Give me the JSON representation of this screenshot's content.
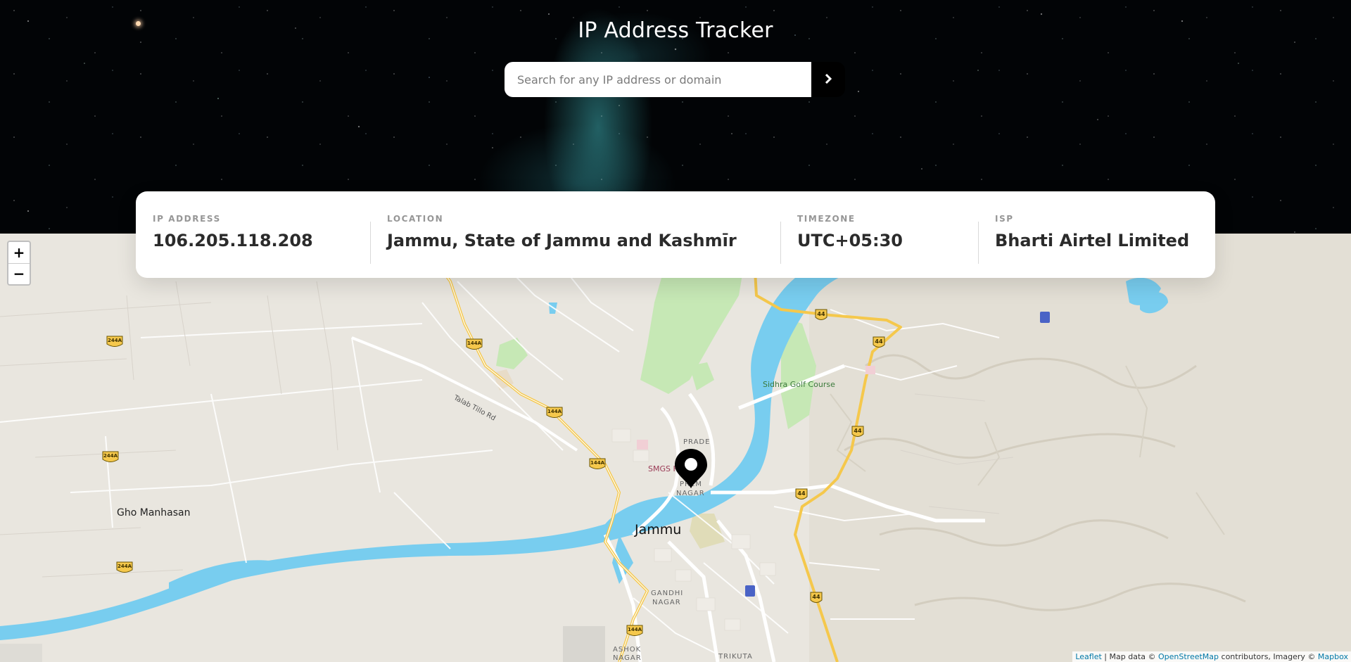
{
  "header": {
    "title": "IP Address Tracker",
    "search_placeholder": "Search for any IP address or domain",
    "search_value": ""
  },
  "info": {
    "ip_label": "IP Address",
    "ip_value": "106.205.118.208",
    "location_label": "Location",
    "location_value": "Jammu, State of Jammu and Kashmīr",
    "timezone_label": "Timezone",
    "timezone_value": "UTC+05:30",
    "isp_label": "ISP",
    "isp_value": "Bharti Airtel Limited"
  },
  "map": {
    "zoom_in": "+",
    "zoom_out": "−",
    "labels": {
      "city": "Jammu",
      "gho": "Gho Manhasan",
      "golf": "Sidhra Golf Course",
      "talab": "Talab Tillo Rd",
      "prade": "PRADE",
      "smgs": "SMGS H",
      "prem": "PREM",
      "nagar1": "NAGAR",
      "gandhi": "GANDHI",
      "nagar2": "NAGAR",
      "ashok": "ASHOK",
      "nagar3": "NAGAR",
      "trikuta": "TRIKUTA"
    },
    "shields": {
      "r244a": "244A",
      "r144a": "144A",
      "r44": "44"
    },
    "attribution": {
      "leaflet": "Leaflet",
      "sep": " | Map data © ",
      "osm": "OpenStreetMap",
      "mid": " contributors, Imagery © ",
      "mapbox": "Mapbox"
    }
  },
  "colors": {
    "water": "#78cdef",
    "land": "#e9e6df",
    "park": "#c6e8b5",
    "highway": "#f5c84c",
    "marker": "#000000"
  }
}
